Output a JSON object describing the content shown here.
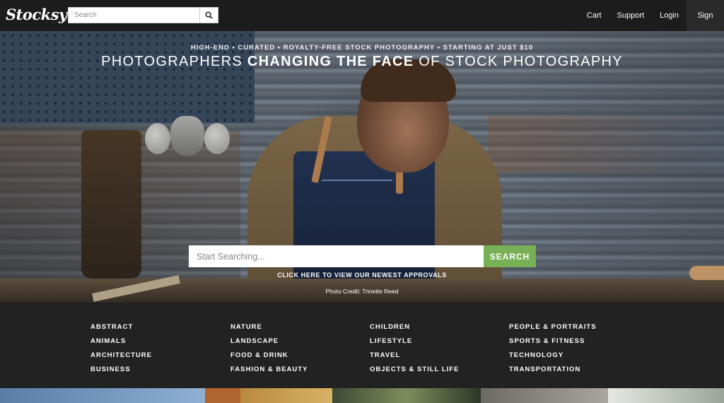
{
  "header": {
    "logo": "Stocksy",
    "search_placeholder": "Search",
    "nav": [
      "Cart",
      "Support",
      "Login",
      "Sign Up"
    ]
  },
  "hero": {
    "kicker": "HIGH-END • CURATED • ROYALTY-FREE STOCK PHOTOGRAPHY • STARTING AT JUST $10",
    "title_pre": "PHOTOGRAPHERS ",
    "title_bold": "CHANGING THE FACE",
    "title_post": " OF STOCK PHOTOGRAPHY",
    "search_placeholder": "Start Searching...",
    "search_button": "SEARCH",
    "approvals_link": "CLICK HERE TO VIEW OUR NEWEST APPROVALS",
    "photo_credit": "Photo Credit: Trinette Reed"
  },
  "categories": [
    [
      "ABSTRACT",
      "ANIMALS",
      "ARCHITECTURE",
      "BUSINESS"
    ],
    [
      "NATURE",
      "LANDSCAPE",
      "FOOD & DRINK",
      "FASHION & BEAUTY"
    ],
    [
      "CHILDREN",
      "LIFESTYLE",
      "TRAVEL",
      "OBJECTS & STILL LIFE"
    ],
    [
      "PEOPLE & PORTRAITS",
      "SPORTS & FITNESS",
      "TECHNOLOGY",
      "TRANSPORTATION"
    ]
  ],
  "colors": {
    "accent_green": "#78b155",
    "header_bg": "#1c1c1c",
    "categories_bg": "#222222"
  },
  "icons": {
    "search": "search-icon"
  }
}
